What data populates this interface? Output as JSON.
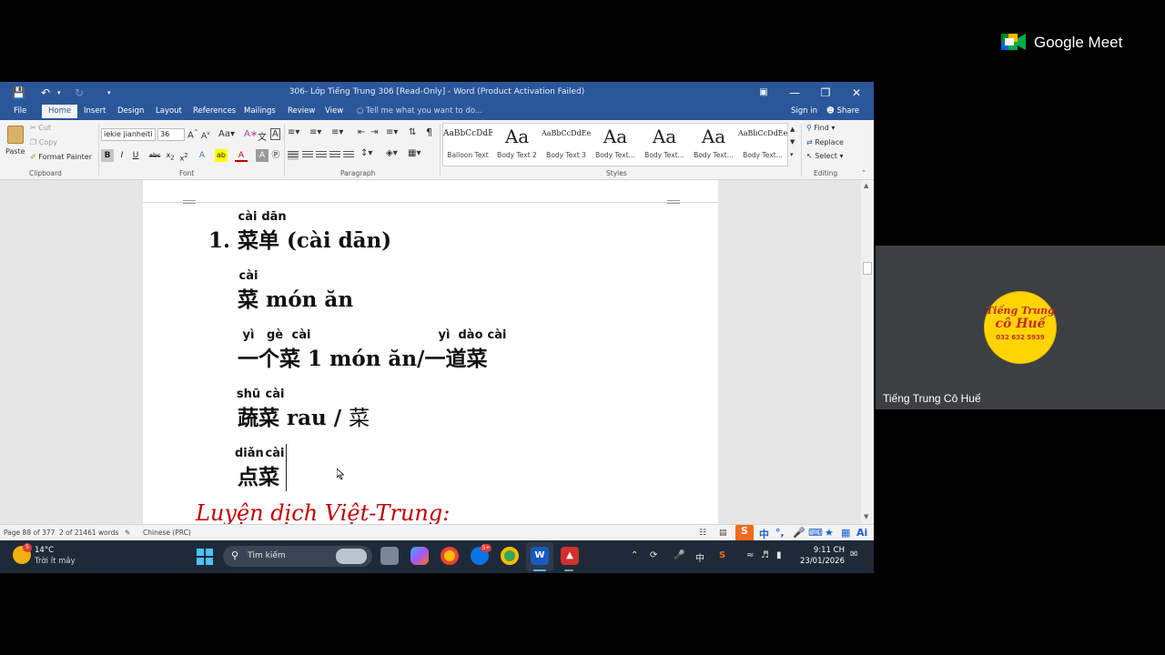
{
  "word": {
    "title": "306- Lớp Tiếng Trung 306 [Read-Only] - Word (Product Activation Failed)",
    "menu": [
      "File",
      "Home",
      "Insert",
      "Design",
      "Layout",
      "References",
      "Mailings",
      "Review",
      "View"
    ],
    "tell_me": "Tell me what you want to do...",
    "sign_in": "Sign in",
    "share": "Share",
    "clipboard": {
      "paste": "Paste",
      "cut": "Cut",
      "copy": "Copy",
      "format_painter": "Format Painter",
      "label": "Clipboard"
    },
    "font": {
      "name": "iekie jianheiti",
      "size": "36",
      "label": "Font"
    },
    "paragraph_label": "Paragraph",
    "styles": [
      {
        "sample": "AaBbCcDdE",
        "name": "Balloon Text"
      },
      {
        "sample": "Aa",
        "name": "Body Text 2"
      },
      {
        "sample": "AaBbCcDdEe",
        "name": "Body Text 3"
      },
      {
        "sample": "Aa",
        "name": "Body Text..."
      },
      {
        "sample": "Aa",
        "name": "Body Text..."
      },
      {
        "sample": "Aa",
        "name": "Body Text..."
      },
      {
        "sample": "AaBbCcDdEe",
        "name": "Body Text..."
      }
    ],
    "styles_label": "Styles",
    "editing": {
      "find": "Find",
      "replace": "Replace",
      "select": "Select",
      "label": "Editing"
    },
    "status": {
      "page": "Page 88 of 377",
      "words": "2 of 21461 words",
      "language": "Chinese (PRC)"
    }
  },
  "document": {
    "line1": {
      "number": "1.",
      "hanzi": "菜单",
      "pinyin_text": " (cài dān)",
      "ruby": [
        "cài",
        "dān"
      ]
    },
    "line2": {
      "hanzi": "菜",
      "text": " món ăn",
      "ruby": [
        "cài"
      ]
    },
    "line3": {
      "hanzi_a": "一个菜",
      "text": " 1 món ăn/",
      "hanzi_b": "一道菜",
      "ruby_a": [
        "yì",
        "gè",
        "cài"
      ],
      "ruby_b": [
        "yì",
        "dào",
        "cài"
      ]
    },
    "line4": {
      "hanzi": "蔬菜",
      "text": " rau / ",
      "hanzi_b": "菜",
      "ruby": [
        "shū",
        "cài"
      ]
    },
    "line5": {
      "hanzi": "点菜",
      "ruby": [
        "diǎn",
        "cài"
      ]
    },
    "heading_partial": "Luyện dịch Việt-Trung:"
  },
  "taskbar": {
    "weather_temp": "14°C",
    "weather_desc": "Trời ít mây",
    "weather_badge": "5",
    "search_placeholder": "Tìm kiếm",
    "ime": "中",
    "time": "9:11 CH",
    "date": "23/01/2026"
  },
  "meet": {
    "brand": "Google Meet",
    "participant_name": "Tiếng Trung Cô Huế",
    "avatar": {
      "line1": "Tiếng Trung",
      "line2": "cô Huế",
      "phone": "032 632 5939"
    }
  },
  "colors": {
    "word_blue": "#2b579a",
    "heading_red": "#c00000",
    "meet_tile": "#3c4043",
    "taskbar": "#1f2a38"
  }
}
